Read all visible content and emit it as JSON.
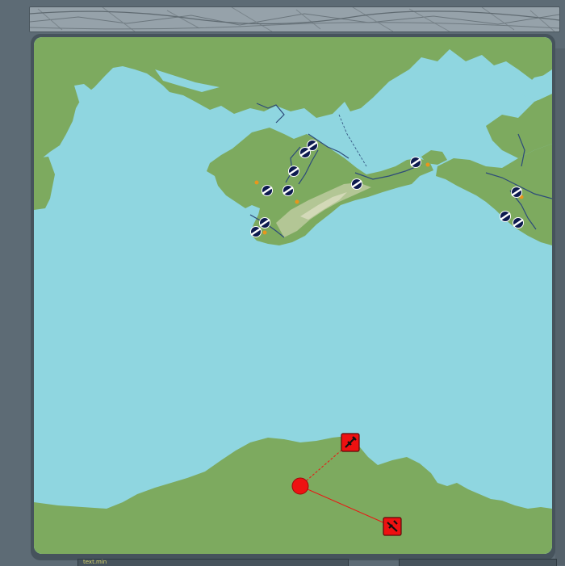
{
  "top_bar": {
    "kind": "street-map-strip"
  },
  "bottom_bar": {
    "field_text": "text.min"
  },
  "colors": {
    "sea": "#8fd6e0",
    "land": "#7daa5f",
    "highland": "#b9c99b",
    "river": "#2d4a7a",
    "frame": "#46535c",
    "background": "#5d6b75",
    "enemy_red": "#ee1111",
    "friendly_navy": "#0d1a4f"
  },
  "icons": {
    "friendly_unit": "airfield-icon",
    "enemy_unit": "fighter-icon",
    "waypoint": "waypoint-circle-icon",
    "town": "town-dot-icon"
  }
}
